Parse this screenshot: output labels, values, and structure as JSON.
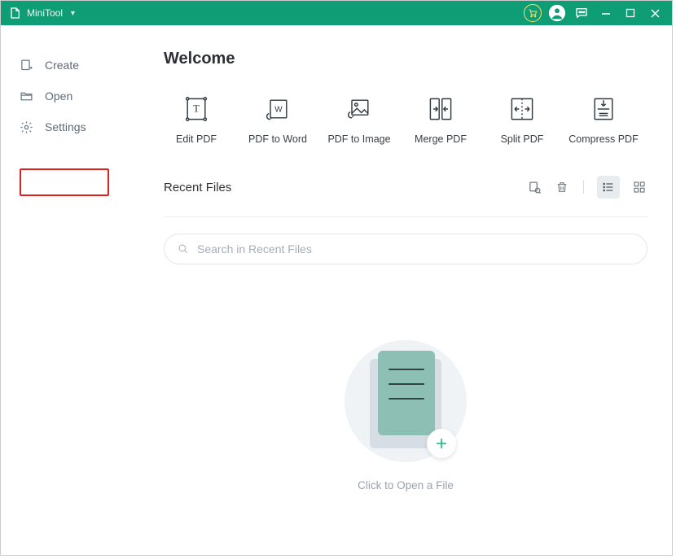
{
  "app": {
    "title": "MiniTool"
  },
  "sidebar": {
    "create": "Create",
    "open": "Open",
    "settings": "Settings"
  },
  "main": {
    "welcome": "Welcome",
    "tools": {
      "edit": "Edit PDF",
      "to_word": "PDF to Word",
      "to_image": "PDF to Image",
      "merge": "Merge PDF",
      "split": "Split PDF",
      "compress": "Compress PDF"
    },
    "recent": {
      "title": "Recent Files",
      "search_placeholder": "Search in Recent Files"
    },
    "drop": {
      "label": "Click to Open a File"
    }
  }
}
